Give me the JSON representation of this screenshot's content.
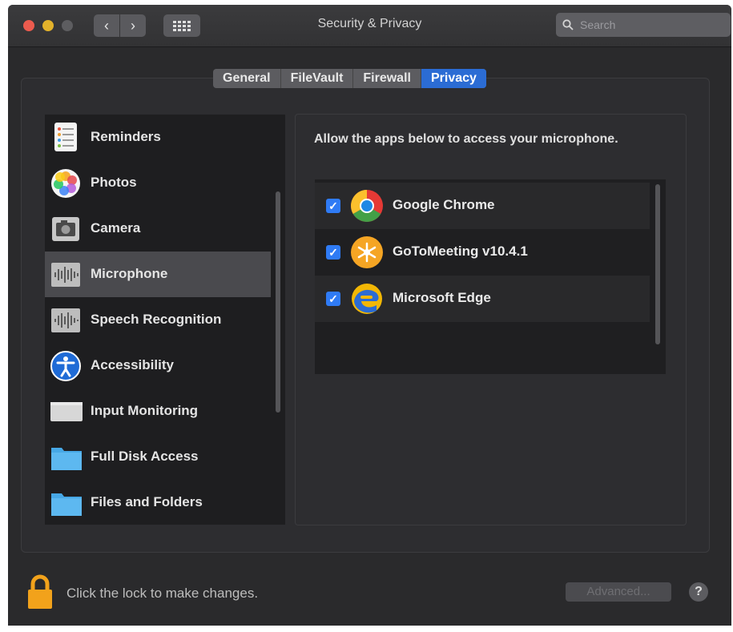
{
  "window": {
    "title": "Security & Privacy"
  },
  "search": {
    "placeholder": "Search"
  },
  "tabs": [
    {
      "label": "General"
    },
    {
      "label": "FileVault"
    },
    {
      "label": "Firewall"
    },
    {
      "label": "Privacy",
      "selected": true
    }
  ],
  "sidebar": {
    "items": [
      {
        "label": "Reminders",
        "icon": "reminders-icon"
      },
      {
        "label": "Photos",
        "icon": "photos-icon"
      },
      {
        "label": "Camera",
        "icon": "camera-icon"
      },
      {
        "label": "Microphone",
        "icon": "microphone-icon",
        "selected": true
      },
      {
        "label": "Speech Recognition",
        "icon": "speech-recognition-icon"
      },
      {
        "label": "Accessibility",
        "icon": "accessibility-icon"
      },
      {
        "label": "Input Monitoring",
        "icon": "keyboard-icon"
      },
      {
        "label": "Full Disk Access",
        "icon": "folder-icon"
      },
      {
        "label": "Files and Folders",
        "icon": "folder-icon"
      }
    ]
  },
  "main": {
    "prompt": "Allow the apps below to access your microphone.",
    "apps": [
      {
        "name": "Google Chrome",
        "checked": true,
        "icon": "chrome-icon"
      },
      {
        "name": "GoToMeeting v10.4.1",
        "checked": true,
        "icon": "gotomeeting-icon"
      },
      {
        "name": "Microsoft Edge",
        "checked": true,
        "icon": "edge-icon"
      }
    ]
  },
  "footer": {
    "lock_text": "Click the lock to make changes.",
    "advanced_label": "Advanced...",
    "help_label": "?"
  },
  "colors": {
    "accent": "#2b6cd4",
    "checkbox": "#2f7bf5",
    "background": "#2a2a2c"
  }
}
